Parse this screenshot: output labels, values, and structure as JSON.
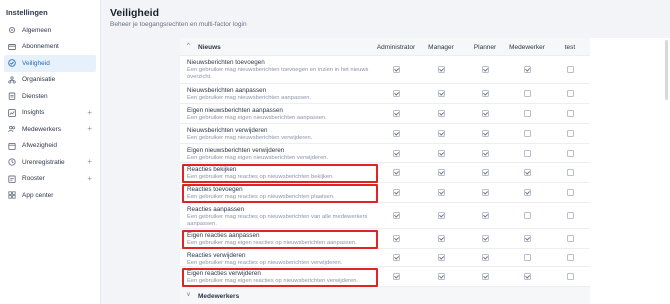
{
  "sidebar": {
    "title": "Instellingen",
    "items": [
      {
        "label": "Algemeen",
        "icon": "gear-icon",
        "plus": false,
        "active": false
      },
      {
        "label": "Abonnement",
        "icon": "card-icon",
        "plus": false,
        "active": false
      },
      {
        "label": "Veiligheid",
        "icon": "shield-check-icon",
        "plus": false,
        "active": true
      },
      {
        "label": "Organisatie",
        "icon": "organization-icon",
        "plus": false,
        "active": false
      },
      {
        "label": "Diensten",
        "icon": "clipboard-icon",
        "plus": false,
        "active": false
      },
      {
        "label": "Insights",
        "icon": "chart-icon",
        "plus": true,
        "active": false
      },
      {
        "label": "Medewerkers",
        "icon": "users-icon",
        "plus": true,
        "active": false
      },
      {
        "label": "Afwezigheid",
        "icon": "calendar-icon",
        "plus": false,
        "active": false
      },
      {
        "label": "Urenregistratie",
        "icon": "clock-icon",
        "plus": true,
        "active": false
      },
      {
        "label": "Rooster",
        "icon": "schedule-icon",
        "plus": true,
        "active": false
      },
      {
        "label": "App center",
        "icon": "grid-icon",
        "plus": false,
        "active": false
      }
    ]
  },
  "header": {
    "title": "Veiligheid",
    "subtitle": "Beheer je toegangsrechten en multi-factor login"
  },
  "table": {
    "columns": [
      "Administrator",
      "Manager",
      "Planner",
      "Medewerker",
      "test"
    ],
    "group": {
      "label": "Nieuws",
      "chevron": "^"
    },
    "next_group": {
      "label": "Medewerkers",
      "chevron": "v"
    },
    "rows": [
      {
        "title": "Nieuwsberichten toevoegen",
        "desc": "Een gebruiker mag nieuwsberichten toevoegen en inzien in het nieuws overzicht.",
        "checks": [
          true,
          true,
          true,
          true,
          false
        ],
        "highlight": false
      },
      {
        "title": "Nieuwsberichten aanpassen",
        "desc": "Een gebruiker mag nieuwsberichten aanpassen.",
        "checks": [
          true,
          true,
          true,
          false,
          false
        ],
        "highlight": false
      },
      {
        "title": "Eigen nieuwsberichten aanpassen",
        "desc": "Een gebruiker mag eigen nieuwsberichten aanpassen.",
        "checks": [
          true,
          true,
          true,
          false,
          false
        ],
        "highlight": false
      },
      {
        "title": "Nieuwsberichten verwijderen",
        "desc": "Een gebruiker mag nieuwsberichten verwijderen.",
        "checks": [
          true,
          true,
          true,
          false,
          false
        ],
        "highlight": false
      },
      {
        "title": "Eigen nieuwsberichten verwijderen",
        "desc": "Een gebruiker mag eigen nieuwsberichten verwijderen.",
        "checks": [
          true,
          true,
          true,
          false,
          false
        ],
        "highlight": false
      },
      {
        "title": "Reacties bekijken",
        "desc": "Een gebruiker mag reacties op nieuwsberichten bekijken.",
        "checks": [
          true,
          true,
          true,
          true,
          false
        ],
        "highlight": true
      },
      {
        "title": "Reacties toevoegen",
        "desc": "Een gebruiker mag reacties op nieuwsberichten plaatsen.",
        "checks": [
          true,
          true,
          true,
          true,
          false
        ],
        "highlight": true
      },
      {
        "title": "Reacties aanpassen",
        "desc": "Een gebruiker mag reacties op nieuwsberichten van alle medewerkers aanpassen.",
        "checks": [
          true,
          true,
          true,
          false,
          false
        ],
        "highlight": false
      },
      {
        "title": "Eigen reacties aanpassen",
        "desc": "Een gebruiker mag eigen reacties op nieuwsberichten aanpassen.",
        "checks": [
          true,
          true,
          true,
          true,
          false
        ],
        "highlight": true
      },
      {
        "title": "Reacties verwijderen",
        "desc": "Een gebruiker mag reacties op nieuwsberichten verwijderen.",
        "checks": [
          true,
          true,
          true,
          false,
          false
        ],
        "highlight": false
      },
      {
        "title": "Eigen reacties verwijderen",
        "desc": "Een gebruiker mag eigen reacties op nieuwsberichten verwijderen.",
        "checks": [
          true,
          true,
          true,
          true,
          false
        ],
        "highlight": true
      }
    ]
  },
  "colors": {
    "highlight": "#e02424",
    "active_bg": "#e6f1fb",
    "active_text": "#2b6cb0"
  }
}
